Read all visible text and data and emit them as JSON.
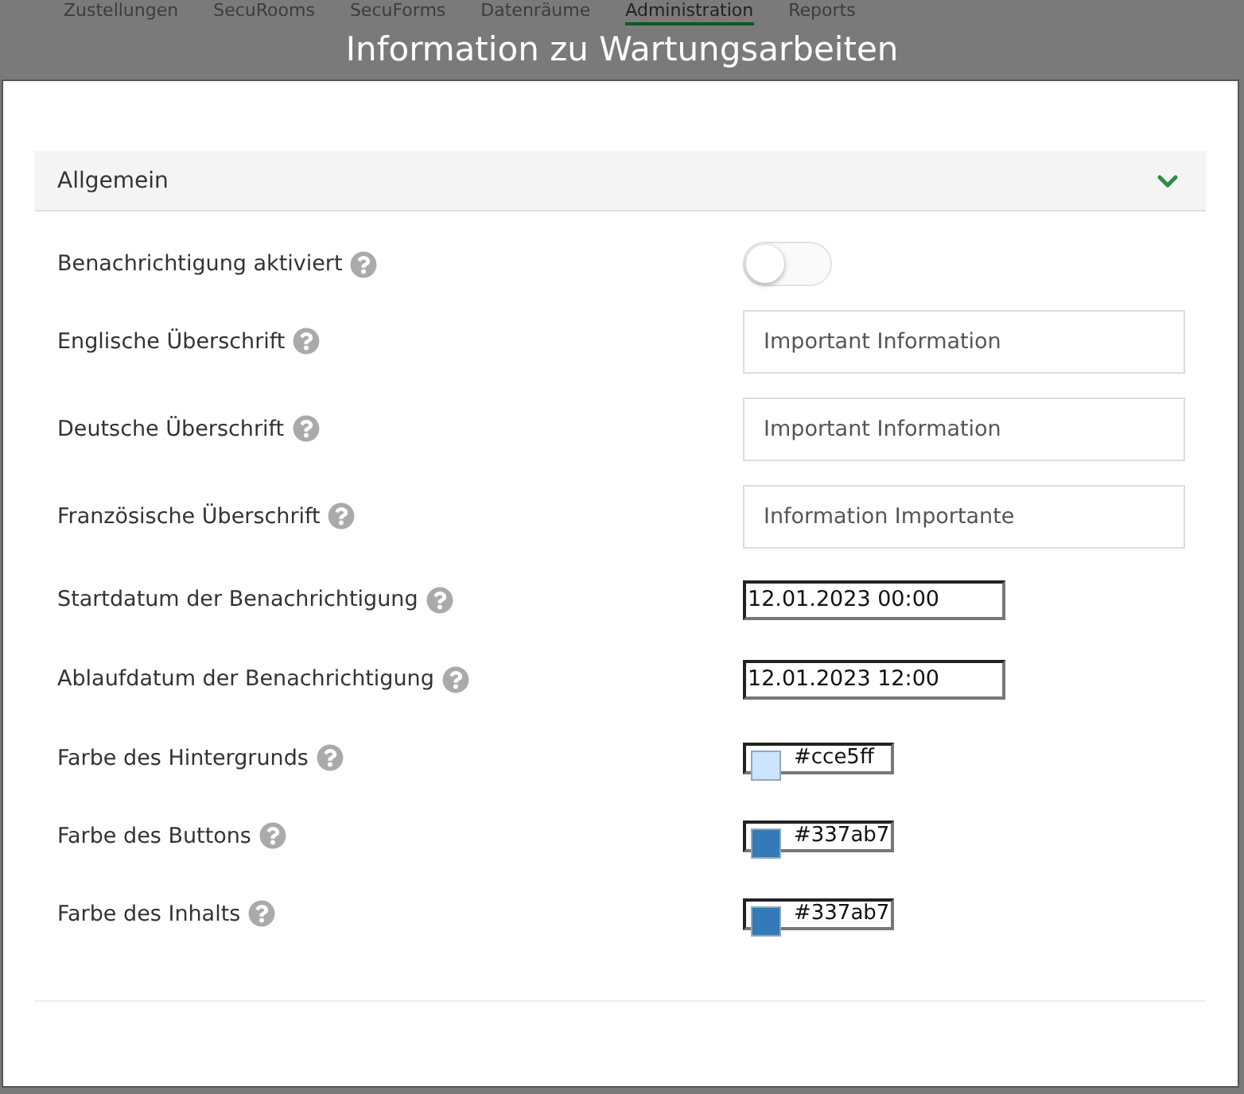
{
  "nav": [
    {
      "label": "Zustellungen",
      "selected": false
    },
    {
      "label": "SecuRooms",
      "selected": false
    },
    {
      "label": "SecuForms",
      "selected": false
    },
    {
      "label": "Datenräume",
      "selected": false
    },
    {
      "label": "Administration",
      "selected": true
    },
    {
      "label": "Reports",
      "selected": false
    }
  ],
  "dialog": {
    "title": "Information zu Wartungsarbeiten",
    "section": {
      "title": "Allgemein",
      "expanded": true,
      "fields": [
        {
          "kind": "toggle",
          "label": "Benachrichtigung aktiviert",
          "on": false
        },
        {
          "kind": "text",
          "label": "Englische Überschrift",
          "value": "Important Information"
        },
        {
          "kind": "text",
          "label": "Deutsche Überschrift",
          "value": "Important Information"
        },
        {
          "kind": "text",
          "label": "Französische Überschrift",
          "value": "Information Importante"
        },
        {
          "kind": "datetime",
          "label": "Startdatum der Benachrichtigung",
          "value": "12.01.2023 00:00"
        },
        {
          "kind": "datetime",
          "label": "Ablaufdatum der Benachrichtigung",
          "value": "12.01.2023 12:00"
        },
        {
          "kind": "color",
          "label": "Farbe des Hintergrunds",
          "value": "#cce5ff",
          "color": "#cce5ff"
        },
        {
          "kind": "color",
          "label": "Farbe des Buttons",
          "value": "#337ab7",
          "color": "#337ab7"
        },
        {
          "kind": "color",
          "label": "Farbe des Inhalts",
          "value": "#337ab7",
          "color": "#337ab7"
        }
      ]
    }
  }
}
